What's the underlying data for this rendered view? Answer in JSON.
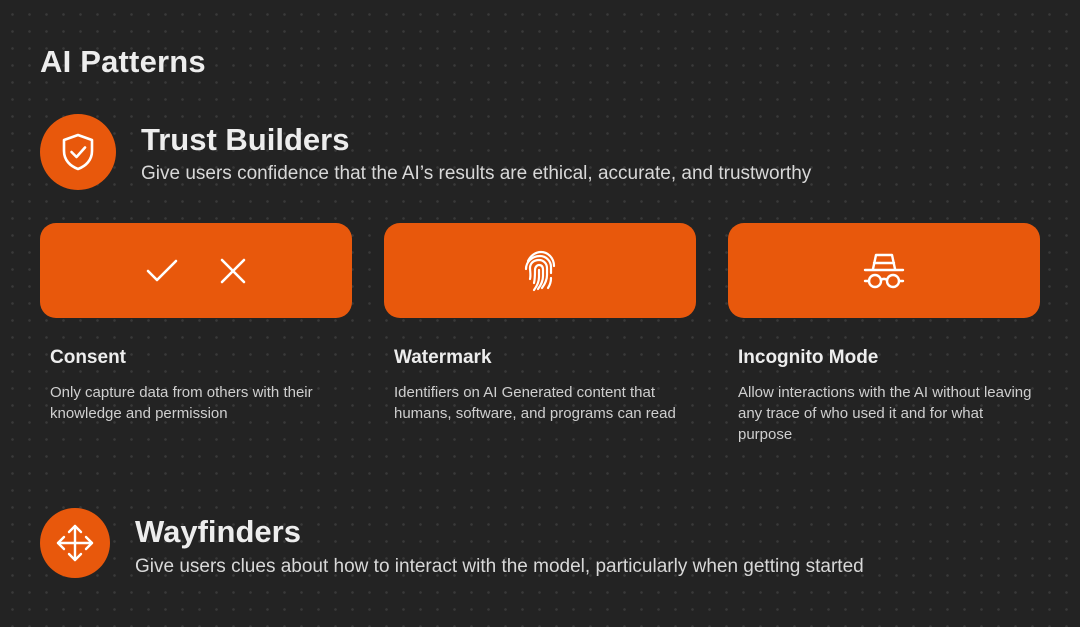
{
  "page": {
    "title": "AI Patterns"
  },
  "colors": {
    "background": "#232323",
    "accent": "#E8580C",
    "text": "#EDEDED"
  },
  "sections": [
    {
      "icon": "shield-check-icon",
      "title": "Trust Builders",
      "description": "Give users confidence that the AI’s results are ethical, accurate, and trustworthy",
      "cards": [
        {
          "icons": [
            "checkmark-icon",
            "x-mark-icon"
          ],
          "title": "Consent",
          "description": "Only capture data from others with their knowledge and permission"
        },
        {
          "icons": [
            "fingerprint-icon"
          ],
          "title": "Watermark",
          "description": "Identifiers on AI Generated content that humans, software, and programs can read"
        },
        {
          "icons": [
            "incognito-icon"
          ],
          "title": "Incognito Mode",
          "description": "Allow interactions with the AI without leaving any trace of who used it and for what purpose"
        }
      ]
    },
    {
      "icon": "move-arrows-icon",
      "title": "Wayfinders",
      "description": "Give users clues about how to interact with the model, particularly when getting started"
    }
  ]
}
